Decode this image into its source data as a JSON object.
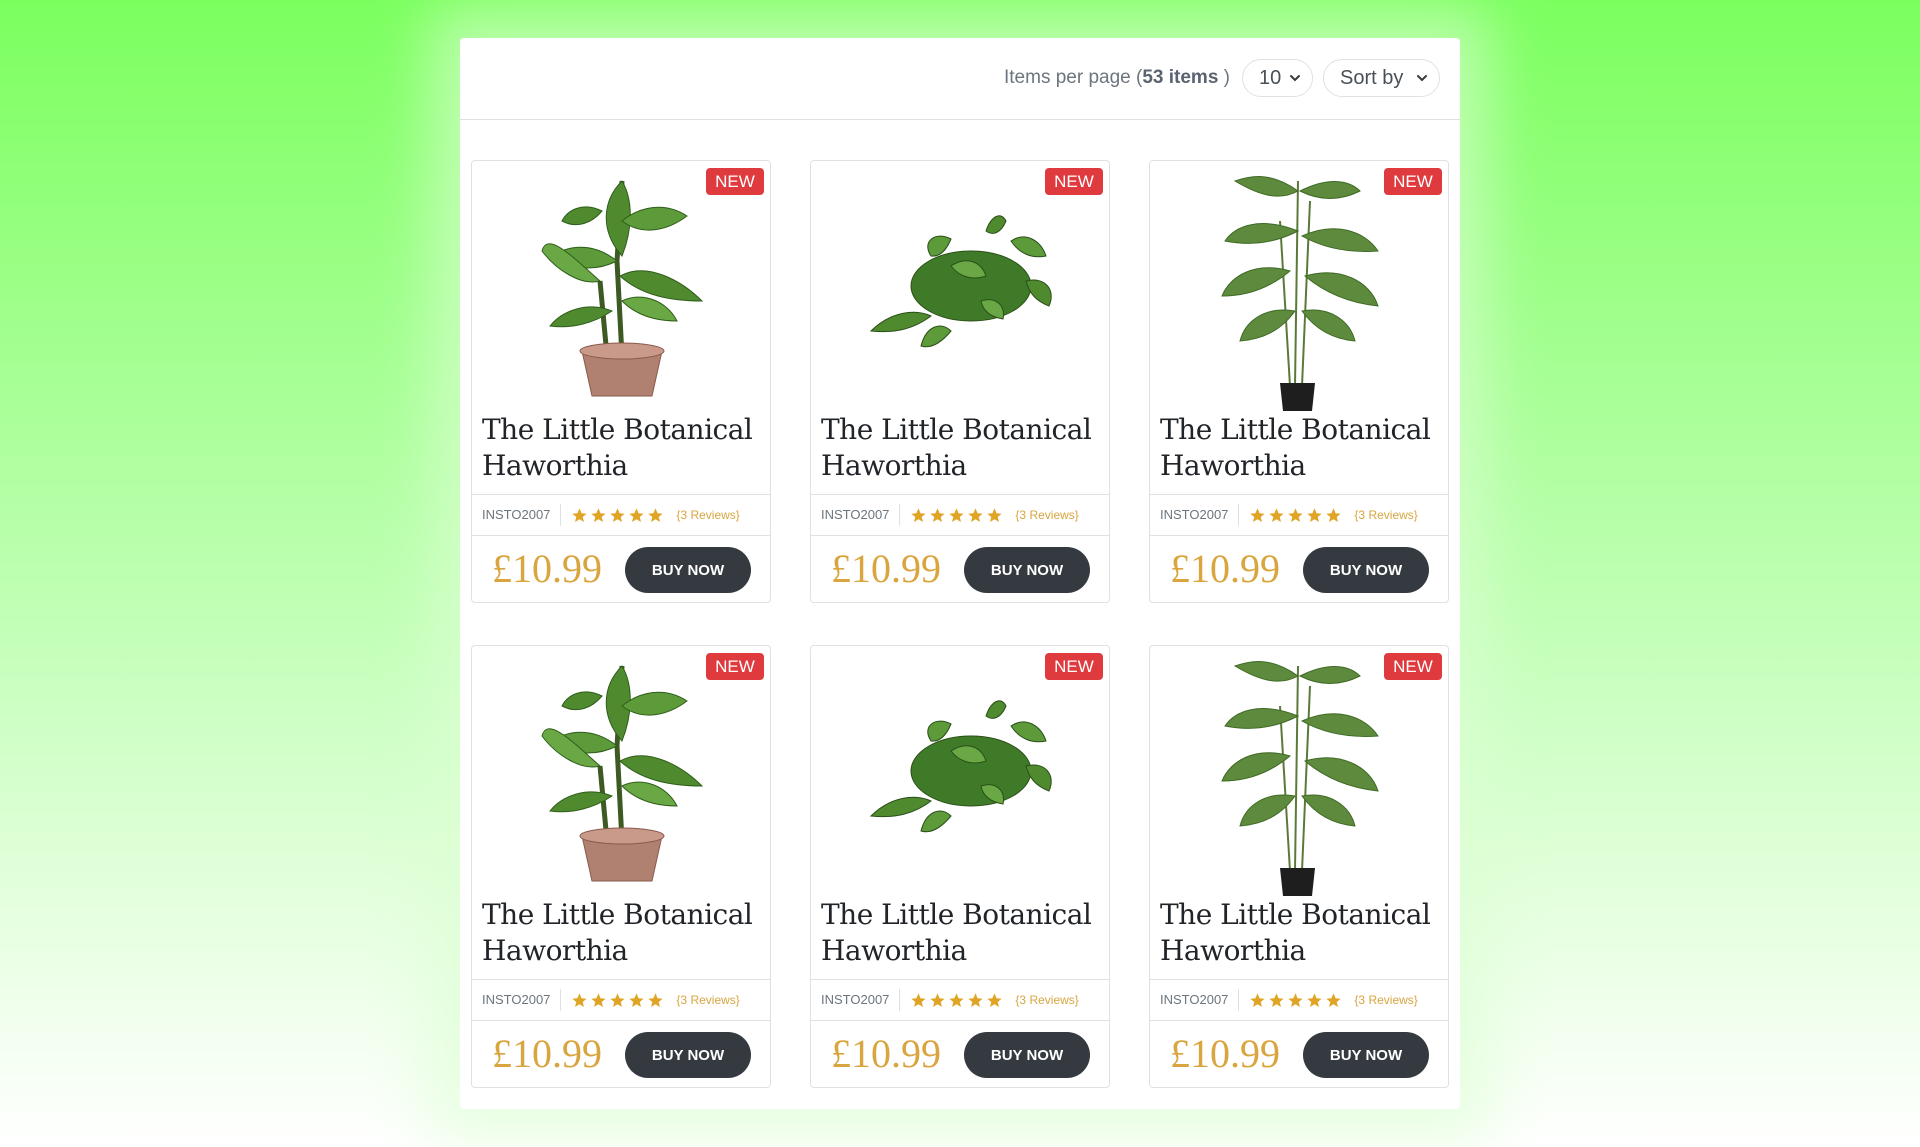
{
  "toolbar": {
    "items_prefix": "Items per page (",
    "items_count": "53 items",
    "items_suffix": " )",
    "per_page_value": "10",
    "sort_value": "Sort by"
  },
  "colors": {
    "accent_price": "#d9a53f",
    "badge_bg": "#df3b3f",
    "button_bg": "#343a40",
    "star": "#e0a526"
  },
  "products": [
    {
      "badge": "NEW",
      "image": "potted-dieffenbachia",
      "title": "The Little Botanical Haworthia",
      "sku": "INSTO2007",
      "rating": 5,
      "reviews": "{3 Reviews}",
      "price": "£10.99",
      "button": "BUY NOW"
    },
    {
      "badge": "NEW",
      "image": "trailing-pothos",
      "title": "The Little Botanical Haworthia",
      "sku": "INSTO2007",
      "rating": 5,
      "reviews": "{3 Reviews}",
      "price": "£10.99",
      "button": "BUY NOW"
    },
    {
      "badge": "NEW",
      "image": "areca-palm",
      "title": "The Little Botanical Haworthia",
      "sku": "INSTO2007",
      "rating": 5,
      "reviews": "{3 Reviews}",
      "price": "£10.99",
      "button": "BUY NOW"
    },
    {
      "badge": "NEW",
      "image": "potted-dieffenbachia",
      "title": "The Little Botanical Haworthia",
      "sku": "INSTO2007",
      "rating": 5,
      "reviews": "{3 Reviews}",
      "price": "£10.99",
      "button": "BUY NOW"
    },
    {
      "badge": "NEW",
      "image": "trailing-pothos",
      "title": "The Little Botanical Haworthia",
      "sku": "INSTO2007",
      "rating": 5,
      "reviews": "{3 Reviews}",
      "price": "£10.99",
      "button": "BUY NOW"
    },
    {
      "badge": "NEW",
      "image": "areca-palm",
      "title": "The Little Botanical Haworthia",
      "sku": "INSTO2007",
      "rating": 5,
      "reviews": "{3 Reviews}",
      "price": "£10.99",
      "button": "BUY NOW"
    }
  ]
}
